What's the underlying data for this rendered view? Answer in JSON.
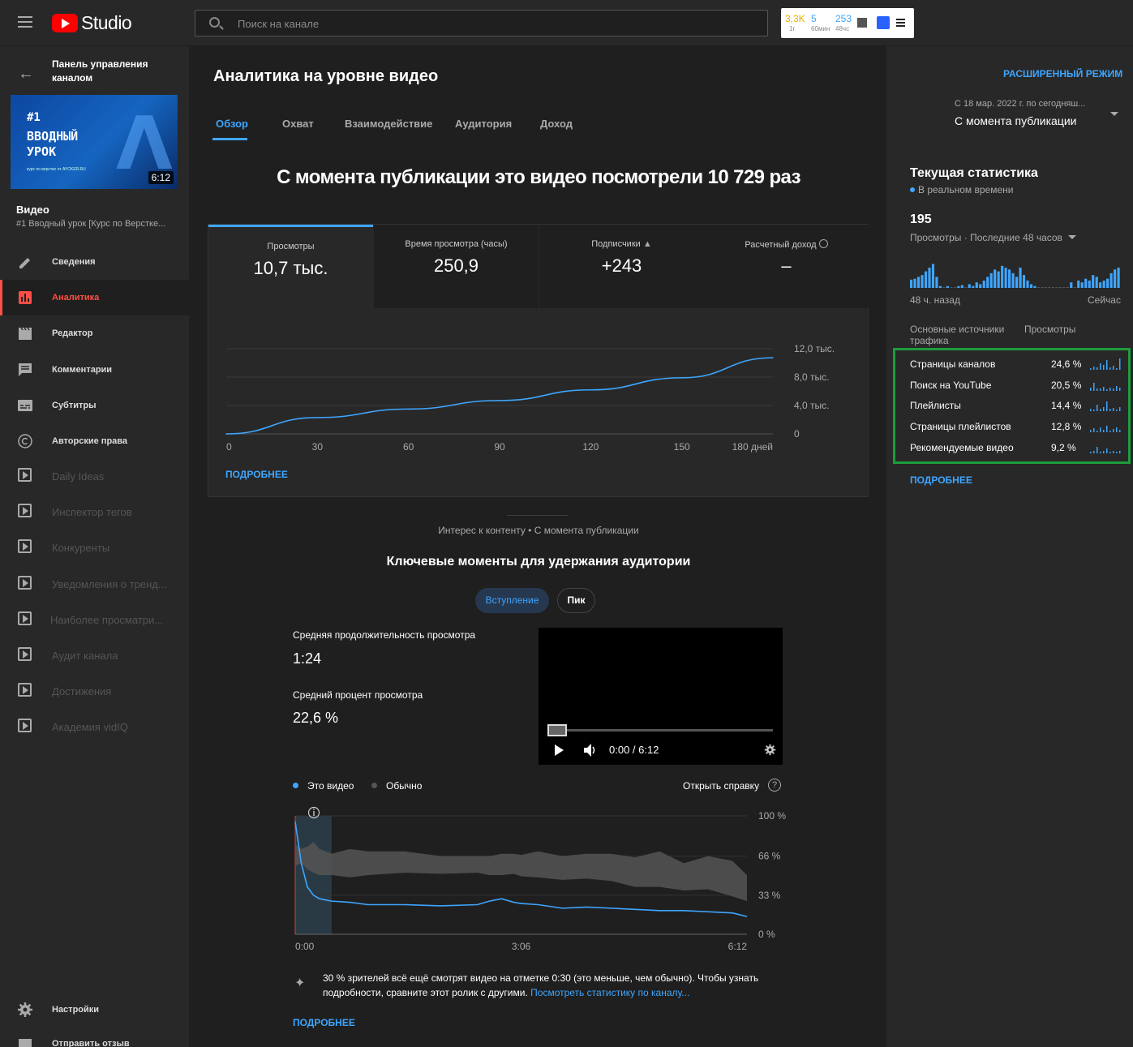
{
  "header": {
    "search_placeholder": "Поиск на канале",
    "studio_label": "Studio",
    "vidiq": {
      "v1": "3,3K",
      "v1_sub": "1г",
      "v2": "5",
      "v2_sub": "60мин",
      "v3": "253",
      "v3_sub": "48чс"
    }
  },
  "sidebar": {
    "dashboard_label": "Панель управления каналом",
    "thumbnail": {
      "line1": "#1",
      "line2": "ВВОДНЫЙ\nУРОК",
      "caption": "курс по верстке от AYCKER.RU",
      "duration": "6:12"
    },
    "video_label": "Видео",
    "video_title": "#1 Вводный урок [Курс по Верстке...",
    "items": [
      {
        "label": "Сведения",
        "icon": "pencil-icon"
      },
      {
        "label": "Аналитика",
        "icon": "analytics-icon"
      },
      {
        "label": "Редактор",
        "icon": "clapper-icon"
      },
      {
        "label": "Комментарии",
        "icon": "comment-icon"
      },
      {
        "label": "Субтитры",
        "icon": "subtitles-icon"
      },
      {
        "label": "Авторские права",
        "icon": "copyright-icon"
      },
      {
        "label": "Daily Ideas",
        "icon": "vidiq-icon"
      },
      {
        "label": "Инспектор тегов",
        "icon": "vidiq-icon"
      },
      {
        "label": "Конкуренты",
        "icon": "vidiq-icon"
      },
      {
        "label": "Уведомления о тренд...",
        "icon": "vidiq-icon"
      },
      {
        "label": "Наиболее просматри...",
        "icon": "vidiq-icon"
      },
      {
        "label": "Аудит канала",
        "icon": "vidiq-icon"
      },
      {
        "label": "Достижения",
        "icon": "vidiq-icon"
      },
      {
        "label": "Академия vidIQ",
        "icon": "vidiq-icon"
      }
    ],
    "settings_label": "Настройки",
    "feedback_label": "Отправить отзыв"
  },
  "main": {
    "title": "Аналитика на уровне видео",
    "tabs": [
      "Обзор",
      "Охват",
      "Взаимодействие",
      "Аудитория",
      "Доход"
    ],
    "advanced_mode": "РАСШИРЕННЫЙ РЕЖИМ",
    "date_range": "С 18 мар. 2022 г. по сегодняш...",
    "date_selected": "С момента публикации",
    "headline": "С момента публикации это видео посмотрели 10 729 раз",
    "stats": [
      {
        "label": "Просмотры",
        "value": "10,7 тыс."
      },
      {
        "label": "Время просмотра (часы)",
        "value": "250,9"
      },
      {
        "label": "Подписчики",
        "value": "+243"
      },
      {
        "label": "Расчетный доход",
        "value": "–"
      }
    ],
    "more_label": "ПОДРОБНЕЕ",
    "interest_label": "Интерес к контенту • С момента публикации",
    "key_moments_title": "Ключевые моменты для удержания аудитории",
    "chips": [
      "Вступление",
      "Пик"
    ],
    "avg_duration_label": "Средняя продолжительность просмотра",
    "avg_duration_value": "1:24",
    "avg_percent_label": "Средний процент просмотра",
    "avg_percent_value": "22,6 %",
    "player_time": "0:00 / 6:12",
    "legend_this": "Это видео",
    "legend_typical": "Обычно",
    "help_link": "Открыть справку",
    "insight_text": "30 % зрителей всё ещё смотрят видео на отметке 0:30 (это меньше, чем обычно). Чтобы узнать подробности, сравните этот ролик с другими.",
    "insight_link": "Посмотреть статистику по каналу...",
    "more2_label": "ПОДРОБНЕЕ"
  },
  "realtime": {
    "title": "Текущая статистика",
    "subtitle": "В реальном времени",
    "value": "195",
    "caption": "Просмотры · Последние 48 часов",
    "bars": [
      9,
      10,
      12,
      14,
      18,
      22,
      26,
      12,
      2,
      0,
      2,
      0,
      0,
      2,
      3,
      0,
      4,
      2,
      6,
      4,
      8,
      12,
      16,
      20,
      18,
      24,
      22,
      20,
      16,
      12,
      22,
      14,
      8,
      4,
      2,
      0,
      0,
      0,
      0,
      0,
      0,
      0,
      0,
      0,
      6,
      0,
      8,
      6,
      10,
      8,
      14,
      12,
      6,
      8,
      10,
      16,
      20,
      22
    ],
    "ago_label": "48 ч. назад",
    "now_label": "Сейчас",
    "traffic_header_source": "Основные источники трафика",
    "traffic_header_views": "Просмотры",
    "traffic": [
      {
        "name": "Страницы каналов",
        "pct": "24,6 %"
      },
      {
        "name": "Поиск на YouTube",
        "pct": "20,5 %"
      },
      {
        "name": "Плейлисты",
        "pct": "14,4 %"
      },
      {
        "name": "Страницы плейлистов",
        "pct": "12,8 %"
      },
      {
        "name": "Рекомендуемые видео",
        "pct": "9,2 %"
      }
    ],
    "more_label": "ПОДРОБНЕЕ"
  },
  "colors": {
    "accent": "#3ea6ff",
    "active_nav": "#ff4e45",
    "highlight_box": "#1e9c3c"
  },
  "chart_data": [
    {
      "type": "line",
      "title": "Просмотры",
      "x": [
        0,
        30,
        60,
        90,
        120,
        150,
        180
      ],
      "x_ticks": [
        "0",
        "30",
        "60",
        "90",
        "120",
        "150",
        "180 дней"
      ],
      "y_ticks": [
        "0",
        "4,0 тыс.",
        "8,0 тыс.",
        "12,0 тыс."
      ],
      "ylim": [
        0,
        12000
      ],
      "series": [
        {
          "name": "Просмотры",
          "values": [
            0,
            2300,
            3500,
            4700,
            6200,
            7900,
            10729
          ]
        }
      ]
    },
    {
      "type": "area",
      "title": "Ключевые моменты для удержания аудитории",
      "x_ticks": [
        "0:00",
        "3:06",
        "6:12"
      ],
      "y_ticks": [
        "0 %",
        "33 %",
        "66 %",
        "100 %"
      ],
      "ylim": [
        0,
        100
      ],
      "x_seconds": [
        0,
        5,
        10,
        15,
        20,
        30,
        45,
        60,
        90,
        120,
        150,
        160,
        170,
        180,
        186,
        200,
        220,
        240,
        260,
        280,
        300,
        320,
        340,
        360,
        372
      ],
      "series": [
        {
          "name": "Это видео",
          "values": [
            95,
            60,
            40,
            33,
            30,
            28,
            27,
            25,
            25,
            24,
            25,
            28,
            30,
            27,
            26,
            25,
            22,
            23,
            22,
            21,
            20,
            20,
            19,
            18,
            15
          ]
        },
        {
          "name": "Обычно",
          "range_low": [
            58,
            60,
            55,
            52,
            50,
            50,
            48,
            50,
            52,
            51,
            52,
            50,
            50,
            51,
            49,
            48,
            46,
            47,
            45,
            40,
            40,
            37,
            38,
            32,
            28
          ],
          "range_high": [
            76,
            72,
            74,
            78,
            72,
            68,
            72,
            70,
            70,
            66,
            66,
            66,
            68,
            68,
            67,
            70,
            66,
            68,
            68,
            65,
            70,
            60,
            66,
            62,
            50
          ]
        }
      ]
    }
  ]
}
